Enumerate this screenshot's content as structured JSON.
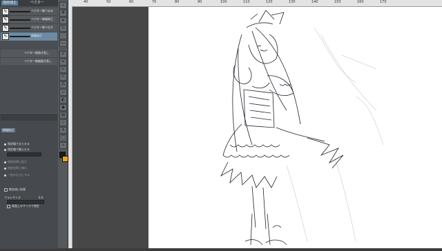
{
  "panel": {
    "tabs": [
      "描線補正",
      "ベクター"
    ],
    "brushes": [
      {
        "label": "ベクター線つまみ",
        "selected": false
      },
      {
        "label": "ベクター線幅修正",
        "selected": false
      },
      {
        "label": "ベクター線つなぎ",
        "selected": false
      },
      {
        "label": "線幅修正",
        "selected": true
      },
      {
        "label": "ベクター線描き直し",
        "selected": false
      },
      {
        "label": "ベクター線幅描き直し",
        "selected": false
      }
    ],
    "subtool_title": "線幅修正",
    "options": [
      {
        "label": "指定幅で太らせる",
        "type": "radio",
        "active": false
      },
      {
        "label": "指定幅で細らせる",
        "type": "radio",
        "active": true
      },
      {
        "label": "指定倍率に拡大",
        "type": "radio",
        "active": false
      },
      {
        "label": "指定倍率に縮小",
        "type": "radio",
        "active": false
      },
      {
        "label": "一定の太さにする",
        "type": "radio",
        "active": false
      },
      {
        "label": "線全体に処理",
        "type": "check",
        "active": false
      }
    ],
    "brush_size_label": "ブラシサイズ",
    "brush_size_value": "6.0",
    "fix_size_label": "画面上のサイズで指定"
  },
  "colors": {
    "main": "#1a1a1a",
    "sub": "#f0a020"
  },
  "ruler": {
    "ticks": [
      "40",
      "50",
      "60",
      "70",
      "80",
      "90",
      "100",
      "110",
      "120",
      "130",
      "140",
      "150",
      "160",
      "170"
    ]
  }
}
